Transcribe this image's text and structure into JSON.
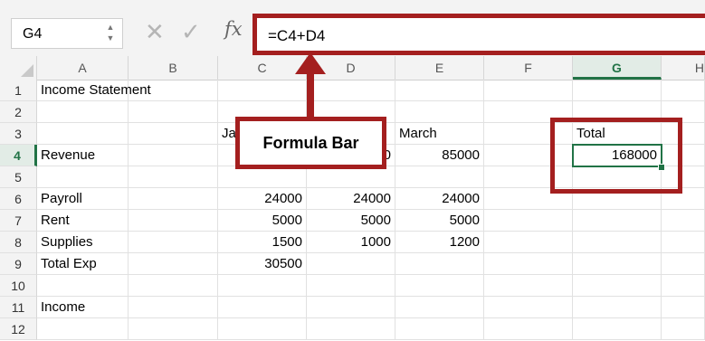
{
  "formula_bar": {
    "name_box": "G4",
    "cancel_icon": "✕",
    "enter_icon": "✓",
    "fx_label": "fx",
    "formula": "=C4+D4"
  },
  "columns": [
    "A",
    "B",
    "C",
    "D",
    "E",
    "F",
    "G",
    "H"
  ],
  "active_column": "G",
  "rows": [
    "1",
    "2",
    "3",
    "4",
    "5",
    "6",
    "7",
    "8",
    "9",
    "10",
    "11",
    "12"
  ],
  "active_row": "4",
  "cells": {
    "A1": "Income Statement",
    "C3": "Ja",
    "E3": "March",
    "G3": "Total",
    "A4": "Revenue",
    "D4": "0",
    "E4": "85000",
    "G4": "168000",
    "A6": "Payroll",
    "C6": "24000",
    "D6": "24000",
    "E6": "24000",
    "A7": "Rent",
    "C7": "5000",
    "D7": "5000",
    "E7": "5000",
    "A8": "Supplies",
    "C8": "1500",
    "D8": "1000",
    "E8": "1200",
    "A9": "Total Exp",
    "C9": "30500",
    "A11": "Income"
  },
  "annotations": {
    "callout_label": "Formula Bar",
    "highlight_color": "#a41f1f",
    "selection_color": "#217346"
  }
}
